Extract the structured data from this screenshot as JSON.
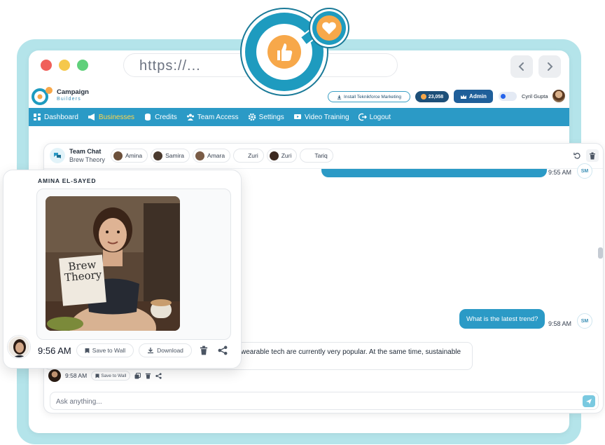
{
  "browser": {
    "url": "https://...",
    "controls": [
      "close",
      "minimize",
      "maximize"
    ]
  },
  "app": {
    "brand_line1": "Campaign",
    "brand_line2": "Builders",
    "install_label": "Install Teknikforce Marketing",
    "credits_count": "23,058",
    "admin_label": "Admin",
    "user_name": "Cyril Gupta"
  },
  "menu": [
    {
      "label": "Dashboard",
      "icon": "dashboard-icon"
    },
    {
      "label": "Businesses",
      "icon": "megaphone-icon",
      "active": true
    },
    {
      "label": "Credits",
      "icon": "coins-icon"
    },
    {
      "label": "Team Access",
      "icon": "team-icon"
    },
    {
      "label": "Settings",
      "icon": "gear-icon"
    },
    {
      "label": "Video Training",
      "icon": "video-icon"
    },
    {
      "label": "Logout",
      "icon": "logout-icon"
    }
  ],
  "chat": {
    "title": "Team Chat",
    "subtitle": "Brew Theory",
    "members": [
      "Amina",
      "Samira",
      "Amara",
      "Zuri",
      "Zuri",
      "Tariq"
    ],
    "messages": {
      "top_time": "9:55 AM",
      "user_avatar": "SM",
      "user_text": "What is the latest trend?",
      "user_time": "9:58 AM",
      "ai_text": "wearable tech are currently very popular. At the same time, sustainable",
      "ai_time": "9:58 AM",
      "save_label": "Save to Wall"
    },
    "input_placeholder": "Ask anything..."
  },
  "card": {
    "name": "AMINA EL-SAYED",
    "sign_line1": "Brew",
    "sign_line2": "Theory",
    "time": "9:56 AM",
    "save_label": "Save to Wall",
    "download_label": "Download"
  },
  "colors": {
    "accent": "#2b9ac6",
    "frame": "#b4e4ea",
    "logo_blue": "#1e9bbf",
    "logo_orange": "#f7a84a"
  }
}
